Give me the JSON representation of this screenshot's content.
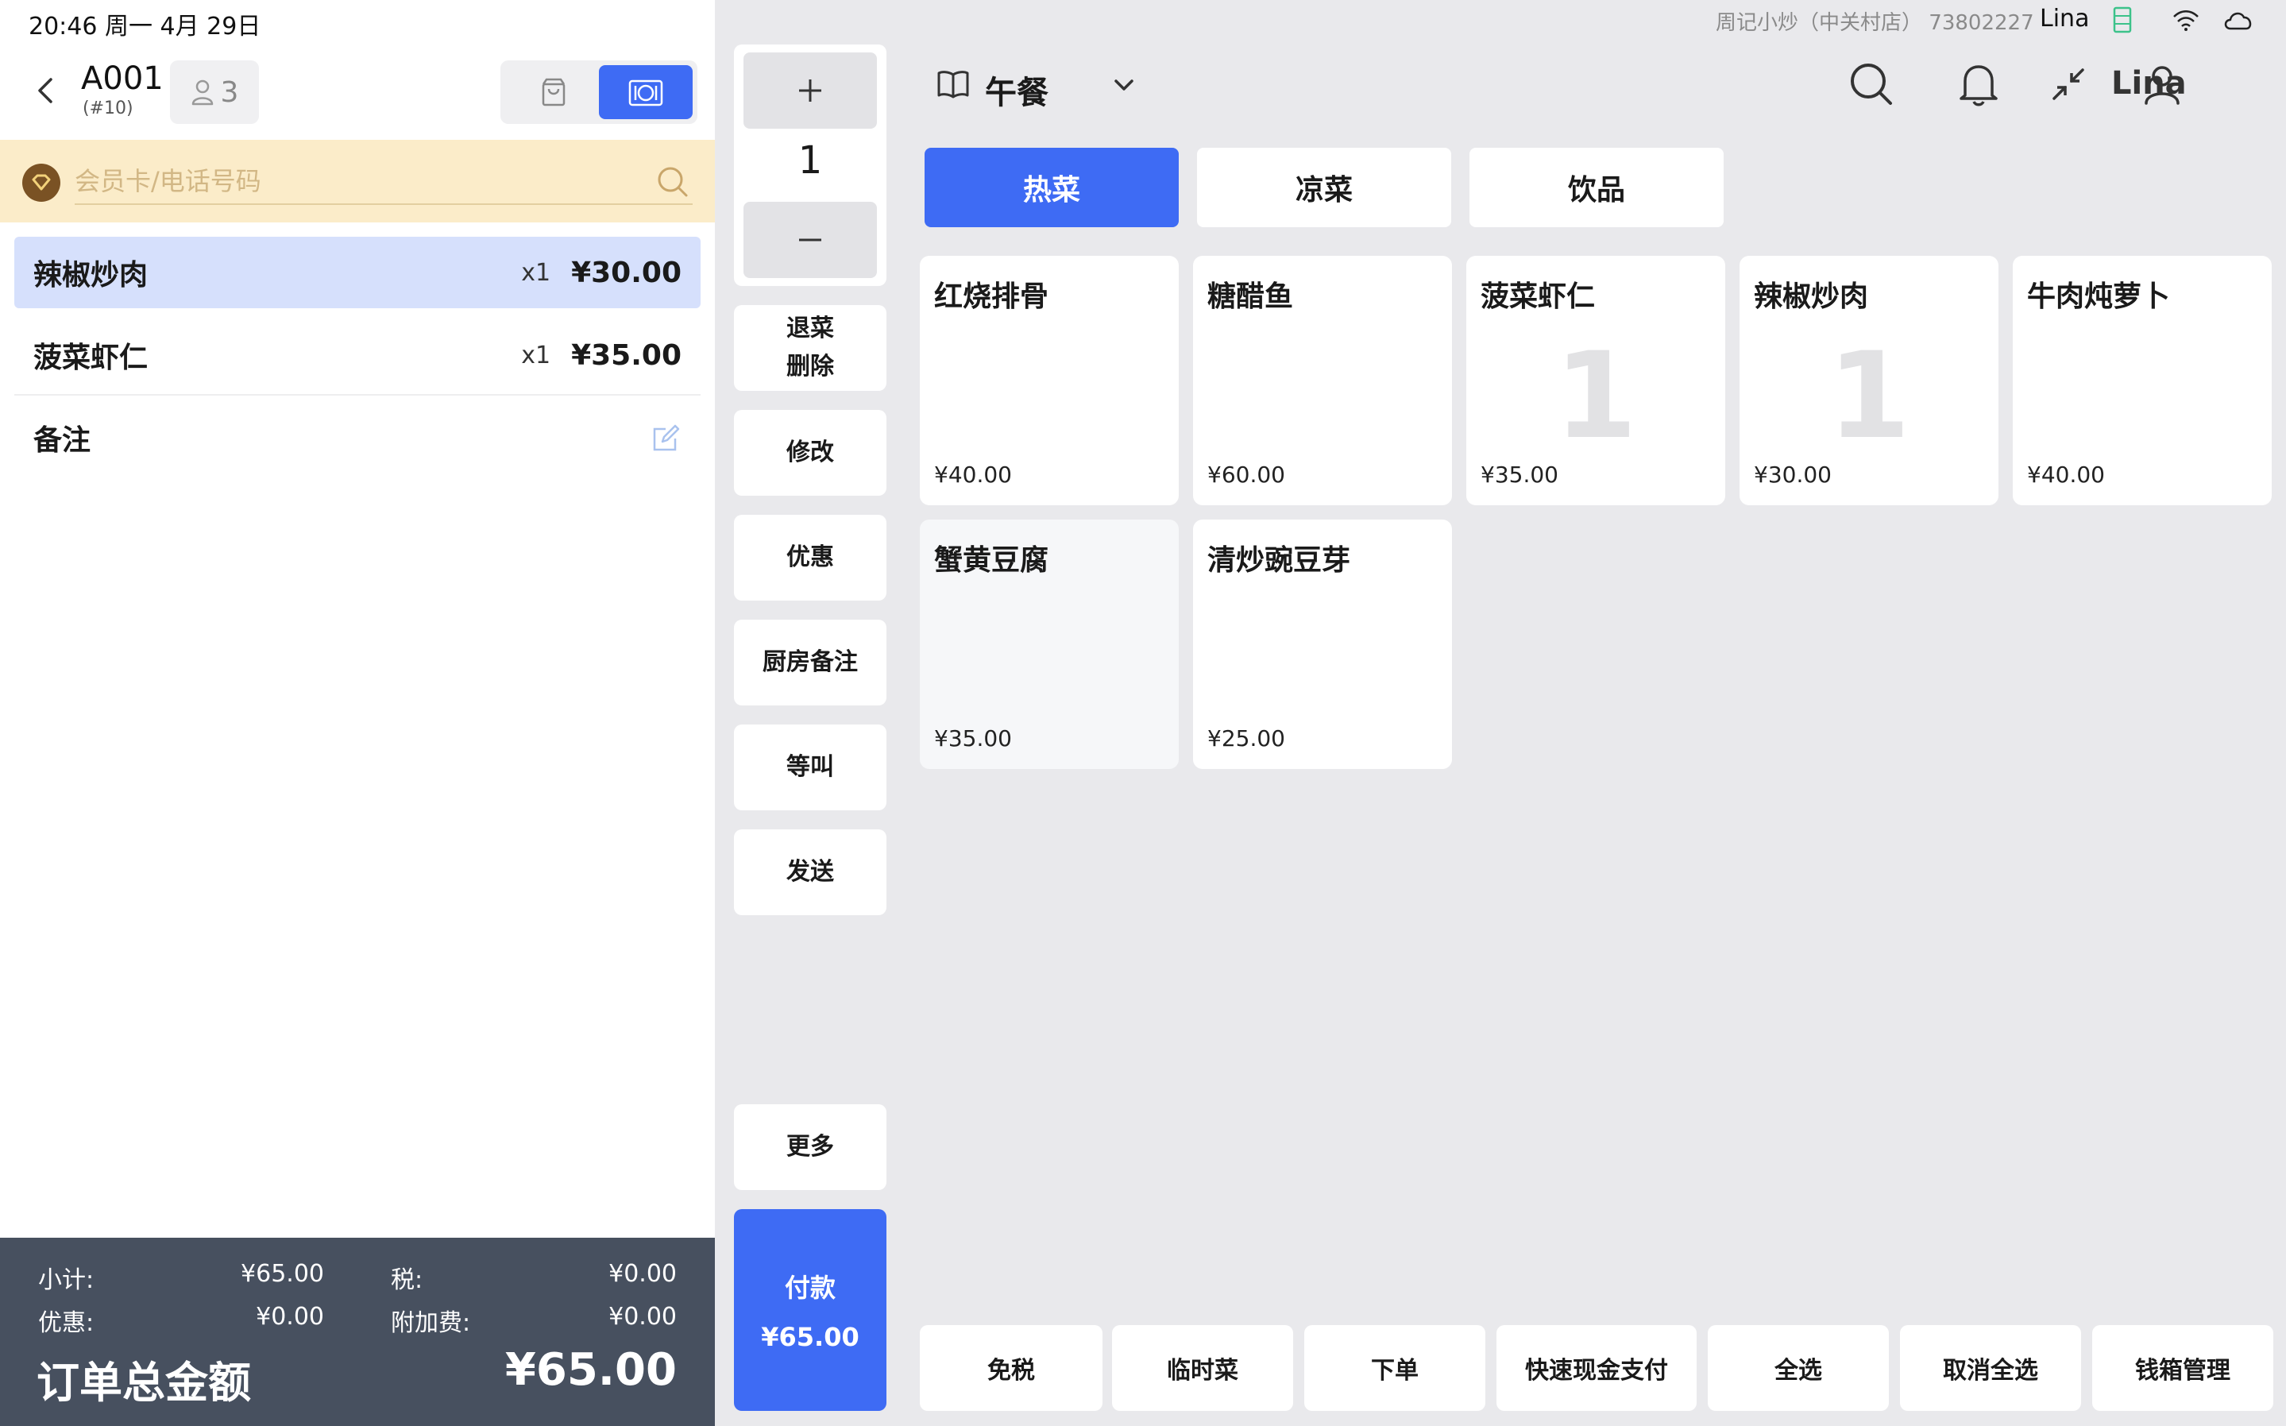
{
  "status_bar": {
    "datetime": "20:46 周一 4月 29日",
    "store_name": "周记小炒（中关村店）",
    "store_id": "73802227",
    "user": "Lina"
  },
  "order": {
    "table": "A001",
    "order_no": "(#10)",
    "guests": "3",
    "member_placeholder": "会员卡/电话号码",
    "items": [
      {
        "name": "辣椒炒肉",
        "qty": "x1",
        "price": "¥30.00",
        "selected": true
      },
      {
        "name": "菠菜虾仁",
        "qty": "x1",
        "price": "¥35.00",
        "selected": false
      }
    ],
    "note_label": "备注",
    "totals": {
      "subtotal_label": "小计:",
      "subtotal": "¥65.00",
      "tax_label": "税:",
      "tax": "¥0.00",
      "discount_label": "优惠:",
      "discount": "¥0.00",
      "surcharge_label": "附加费:",
      "surcharge": "¥0.00",
      "grand_label": "订单总金额",
      "grand": "¥65.00"
    }
  },
  "actions": {
    "quantity": "1",
    "void_line1": "退菜",
    "void_line2": "删除",
    "modify": "修改",
    "discount": "优惠",
    "kitchen_note": "厨房备注",
    "hold": "等叫",
    "send": "发送",
    "more": "更多",
    "pay_label": "付款",
    "pay_amount": "¥65.00"
  },
  "menu": {
    "title": "午餐",
    "user": "Lina",
    "categories": [
      "热菜",
      "凉菜",
      "饮品"
    ],
    "active_category": "热菜",
    "dishes": [
      {
        "name": "红烧排骨",
        "price": "¥40.00",
        "count": ""
      },
      {
        "name": "糖醋鱼",
        "price": "¥60.00",
        "count": ""
      },
      {
        "name": "菠菜虾仁",
        "price": "¥35.00",
        "count": "1"
      },
      {
        "name": "辣椒炒肉",
        "price": "¥30.00",
        "count": "1"
      },
      {
        "name": "牛肉炖萝卜",
        "price": "¥40.00",
        "count": ""
      },
      {
        "name": "蟹黄豆腐",
        "price": "¥35.00",
        "count": ""
      },
      {
        "name": "清炒豌豆芽",
        "price": "¥25.00",
        "count": ""
      }
    ]
  },
  "bottom_bar": [
    "免税",
    "临时菜",
    "下单",
    "快速现金支付",
    "全选",
    "取消全选",
    "钱箱管理"
  ],
  "colors": {
    "accent": "#3e6bf4",
    "selected_row": "#d6e0fc",
    "member_bar": "#fbecc9",
    "totals_bg": "#47505f",
    "background": "#e9e9ec"
  }
}
